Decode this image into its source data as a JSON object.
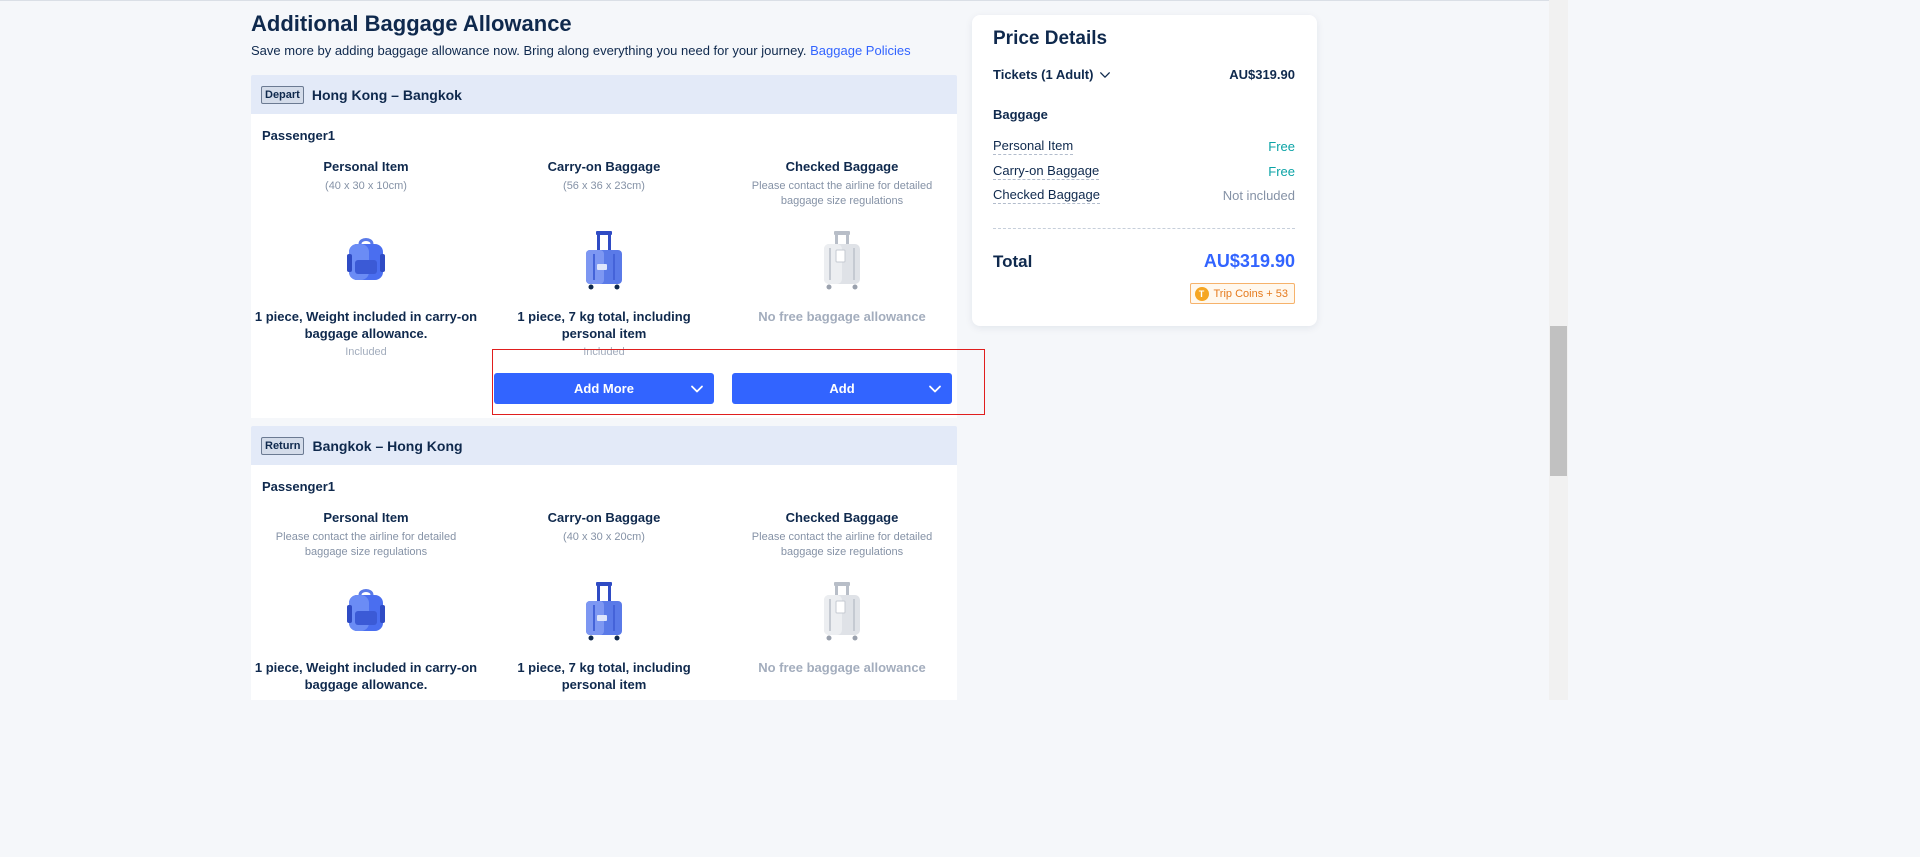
{
  "page": {
    "title": "Additional Baggage Allowance",
    "subtitle": "Save more by adding baggage allowance now. Bring along everything you need for your journey.",
    "policy_link": "Baggage Policies"
  },
  "segments": [
    {
      "tag": "Depart",
      "route": "Hong Kong – Bangkok",
      "passenger": "Passenger1",
      "personal": {
        "title": "Personal Item",
        "size": "(40 x 30 x 10cm)",
        "desc": "1 piece, Weight included in carry-on baggage allowance.",
        "status": "Included"
      },
      "carryon": {
        "title": "Carry-on Baggage",
        "size": "(56 x 36 x 23cm)",
        "desc": "1 piece, 7 kg total, including personal item",
        "status": "Included",
        "button": "Add More"
      },
      "checked": {
        "title": "Checked Baggage",
        "size": "Please contact the airline for detailed baggage size regulations",
        "desc": "No free baggage allowance",
        "button": "Add"
      }
    },
    {
      "tag": "Return",
      "route": "Bangkok – Hong Kong",
      "passenger": "Passenger1",
      "personal": {
        "title": "Personal Item",
        "size": "Please contact the airline for detailed baggage size regulations",
        "desc": "1 piece, Weight included in carry-on baggage allowance."
      },
      "carryon": {
        "title": "Carry-on Baggage",
        "size": "(40 x 30 x 20cm)",
        "desc": "1 piece, 7 kg total, including personal item"
      },
      "checked": {
        "title": "Checked Baggage",
        "size": "Please contact the airline for detailed baggage size regulations",
        "desc": "No free baggage allowance"
      }
    }
  ],
  "price": {
    "title": "Price Details",
    "tickets_label": "Tickets (1 Adult)",
    "tickets_value": "AU$319.90",
    "baggage_label": "Baggage",
    "items": [
      {
        "label": "Personal Item",
        "value": "Free"
      },
      {
        "label": "Carry-on Baggage",
        "value": "Free"
      },
      {
        "label": "Checked Baggage",
        "value": "Not included"
      }
    ],
    "total_label": "Total",
    "total_value": "AU$319.90",
    "coins_label": "Trip Coins + 53"
  },
  "colors": {
    "accent": "#3264ff",
    "free": "#0ba3a6",
    "highlight": "#e01e1e"
  }
}
